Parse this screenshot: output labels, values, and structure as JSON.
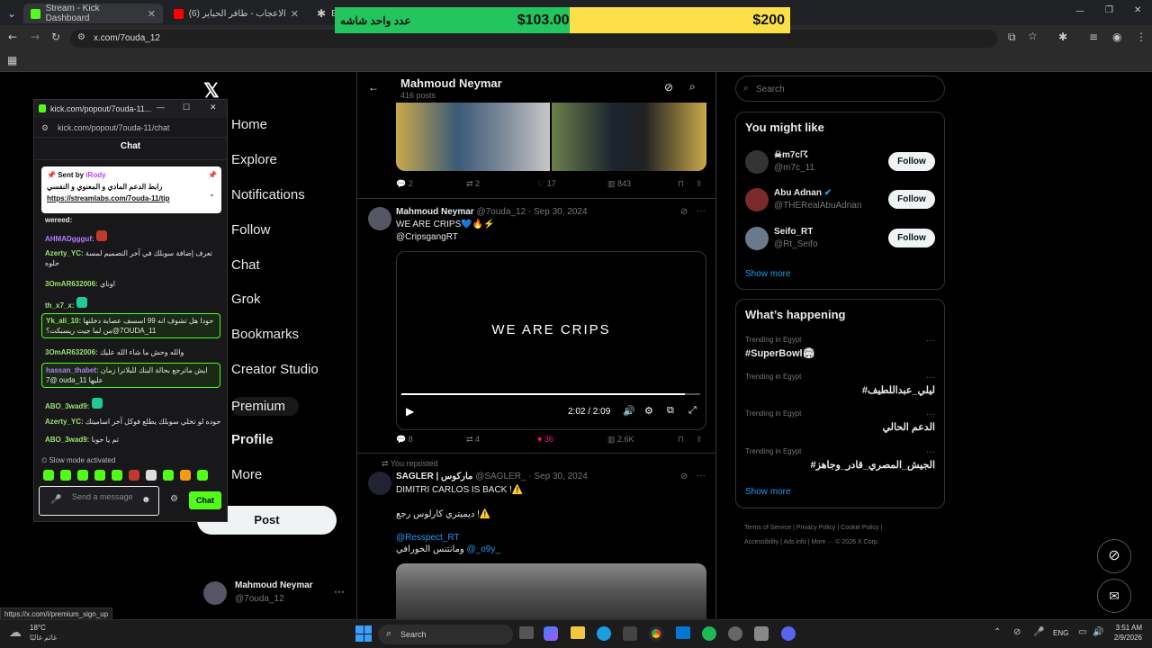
{
  "browser": {
    "tabs": [
      {
        "label": "Stream - Kick Dashboard",
        "color": "#53fc18"
      },
      {
        "label": "(6) نظرات الاعجاب - طافر الحياير",
        "color": "#ff0000"
      },
      {
        "label": "Ex",
        "color": "#bbbbbb"
      }
    ],
    "url": "x.com/7ouda_12",
    "status_url": "https://x.com/i/premium_sign_up"
  },
  "donation": {
    "label": "عدد واحد شاشه",
    "current": "$103.00",
    "goal": "$200",
    "progress_fraction": 0.515
  },
  "x_nav": {
    "items": [
      "Home",
      "Explore",
      "Notifications",
      "Follow",
      "Chat",
      "Grok",
      "Bookmarks",
      "Creator Studio",
      "Premium",
      "Profile",
      "More"
    ],
    "post_label": "Post",
    "account_name": "Mahmoud Neymar",
    "account_handle": "@7ouda_12"
  },
  "profile_header": {
    "name": "Mahmoud Neymar",
    "posts": "416 posts"
  },
  "post1_actions": {
    "replies": "2",
    "reposts": "2",
    "likes": "17",
    "views": "843"
  },
  "post2": {
    "name": "Mahmoud Neymar",
    "handle": "@7ouda_12",
    "date": "· Sep 30, 2024",
    "text": "WE ARE CRIPS💙🔥⚡",
    "mention": "@CripsgangRT",
    "video_caption": "WE ARE CRIPS",
    "video_time": "2:02 / 2:09",
    "video_progress_fraction": 0.95,
    "actions": {
      "replies": "8",
      "reposts": "4",
      "likes": "36",
      "views": "2.6K"
    }
  },
  "post3": {
    "repost_label": "You reposted",
    "name": "SAGLER | ماركوس",
    "handle": "@SAGLER_",
    "date": "· Sep 30, 2024",
    "line1": "DIMITRI CARLOS IS BACK !⚠️",
    "line2": "⚠️! ديميتري كارلوس رجع",
    "mention1": "@Resspect_RT",
    "line3": "ومانتنس الخورافي",
    "mention2": "@_o9y_"
  },
  "search": {
    "placeholder": "Search"
  },
  "might_like": {
    "title": "You might like",
    "users": [
      {
        "name": "☠m7c☈",
        "handle": "@m7c_11",
        "follow": "Follow"
      },
      {
        "name": "Abu Adnan",
        "handle": "@THERealAbuAdnan",
        "follow": "Follow"
      },
      {
        "name": "Seifo_RT",
        "handle": "@Rt_Seifo",
        "follow": "Follow"
      }
    ],
    "show_more": "Show more"
  },
  "happening": {
    "title": "What’s happening",
    "trends": [
      {
        "context": "Trending in Egypt",
        "name": "#SuperBowl🏟"
      },
      {
        "context": "Trending in Egypt",
        "name": "#ليلي_عبداللطيف"
      },
      {
        "context": "Trending in Egypt",
        "name": "الدعم الحالي"
      },
      {
        "context": "Trending in Egypt",
        "name": "#الجيش_المصري_قادر_وجاهز"
      }
    ],
    "show_more": "Show more"
  },
  "footer_links": [
    "Terms of Service",
    "Privacy Policy",
    "Cookie Policy",
    "Accessibility",
    "Ads info",
    "More ···",
    "© 2026 X Corp."
  ],
  "kick": {
    "window_title": "kick.com/popout/7ouda-11...",
    "url": "kick.com/popout/7ouda-11/chat",
    "chat_title": "Chat",
    "pinned_sender": "Sent by",
    "pinned_user": "iRody",
    "pinned_line1": "رابط الدعم المادي و المعنوي و النفسي",
    "pinned_link": "https://streamlabs.com/7ouda-11/tip",
    "messages": [
      {
        "user": "wereed:",
        "text": "",
        "color": "#e5e5e5"
      },
      {
        "user": "AHMADggguf:",
        "text": "",
        "color": "#b57bff"
      },
      {
        "user": "Azerty_YC:",
        "text": "تعرف إضافة سوبلك في آخر التصميم لمسة حلوه",
        "color": "#9be36b"
      },
      {
        "user": "3OmAR632006:",
        "text": "اوناي",
        "color": "#9be36b"
      },
      {
        "user": "th_x7_x:",
        "text": "",
        "color": "#9be36b"
      },
      {
        "user": "Yk_ali_10:",
        "text": "حودا هل تشوف انه 99 اسسف عصابة دخلتها 7@من لما جيت ريسبكت؟OUDA_11",
        "color": "#9be36b"
      },
      {
        "user": "3OmAR632006:",
        "text": "والله وحش ما شاء الله عليك",
        "color": "#9be36b"
      },
      {
        "user": "hassan_thabet:",
        "text": "ايش ماترجع بحالة البنك للبلاترا زمان 7@ ouda_11 عليها",
        "color": "#b57bff"
      },
      {
        "user": "ABO_3wad9:",
        "text": "",
        "color": "#9be36b"
      },
      {
        "user": "Azerty_YC:",
        "text": "حوده لو تخلي سوبلك يطلع فوكل آخر اساميتك",
        "color": "#9be36b"
      },
      {
        "user": "ABO_3wad9:",
        "text": "تم يا حوبا",
        "color": "#9be36b"
      }
    ],
    "slow_mode": "Slow mode activated",
    "input_placeholder": "Send a message",
    "chat_button": "Chat"
  },
  "taskbar": {
    "weather_temp": "18°C",
    "weather_desc": "غائم غالبًا",
    "search_label": "Search",
    "lang": "ENG",
    "time": "3:51 AM",
    "date": "2/9/2026"
  }
}
